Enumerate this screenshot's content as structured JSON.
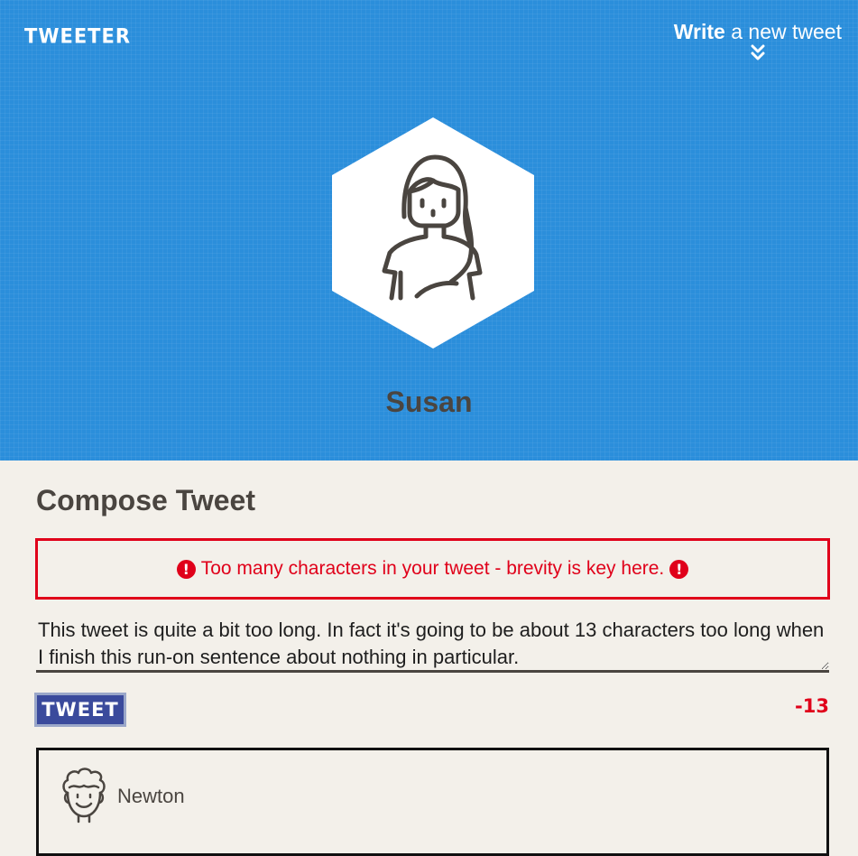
{
  "nav": {
    "brand": "TWEETER",
    "write_bold": "Write",
    "write_rest": " a new tweet",
    "chevron_icon": "double-chevron-down-icon"
  },
  "profile": {
    "name": "Susan",
    "avatar_icon": "woman-avatar-icon"
  },
  "compose": {
    "title": "Compose Tweet",
    "error_message": "Too many characters in your tweet - brevity is key here.",
    "error_icon": "exclamation-circle-icon",
    "tweet_text": "This tweet is quite a bit too long. In fact it's going to be about 13 characters too long when I finish this run-on sentence about nothing in particular.",
    "button_label": "TWEET",
    "counter": "-13"
  },
  "tweets": [
    {
      "author": "Newton",
      "avatar_icon": "curly-hair-man-avatar-icon"
    }
  ],
  "colors": {
    "hero_bg": "#2b8edb",
    "page_bg": "#f3f0ea",
    "error": "#e0001a",
    "text_dark": "#4a4540",
    "button_bg": "#3a4a9c"
  }
}
